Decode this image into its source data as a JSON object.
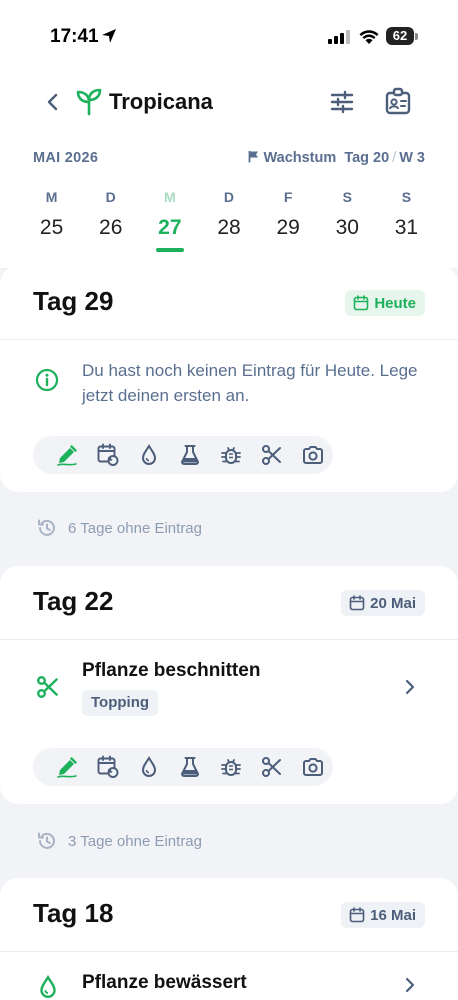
{
  "status_bar": {
    "time": "17:41",
    "battery": "62"
  },
  "header": {
    "title": "Tropicana"
  },
  "date_bar": {
    "month": "MAI 2026",
    "phase": "Wachstum",
    "day": "Tag 20",
    "week": "W 3"
  },
  "week": [
    {
      "wd": "M",
      "num": "25"
    },
    {
      "wd": "D",
      "num": "26"
    },
    {
      "wd": "M",
      "num": "27",
      "active": true
    },
    {
      "wd": "D",
      "num": "28"
    },
    {
      "wd": "F",
      "num": "29"
    },
    {
      "wd": "S",
      "num": "30"
    },
    {
      "wd": "S",
      "num": "31"
    }
  ],
  "cards": [
    {
      "tag": "Tag 29",
      "badge": "Heute",
      "info": "Du hast noch keinen Eintrag für Heute. Lege jetzt deinen ersten an."
    },
    {
      "tag": "Tag 22",
      "badge": "20 Mai",
      "entry": "Pflanze beschnitten",
      "chip": "Topping"
    },
    {
      "tag": "Tag 18",
      "badge": "16 Mai",
      "entry": "Pflanze bewässert"
    }
  ],
  "gaps": [
    "6 Tage ohne Eintrag",
    "3 Tage ohne Eintrag"
  ],
  "colors": {
    "accent": "#1DB15C",
    "muted": "#5A6F90",
    "background": "#F1F3F6"
  },
  "icons": [
    "location-arrow-icon",
    "signal-icon",
    "wifi-icon",
    "battery-icon",
    "back-chevron-icon",
    "sprout-icon",
    "sliders-icon",
    "id-badge-icon",
    "flag-icon",
    "calendar-icon",
    "info-icon",
    "scissors-icon",
    "water-drop-icon",
    "chevron-right-icon",
    "edit-icon",
    "calendar-repeat-icon",
    "flask-icon",
    "bug-icon",
    "camera-icon",
    "history-icon"
  ]
}
